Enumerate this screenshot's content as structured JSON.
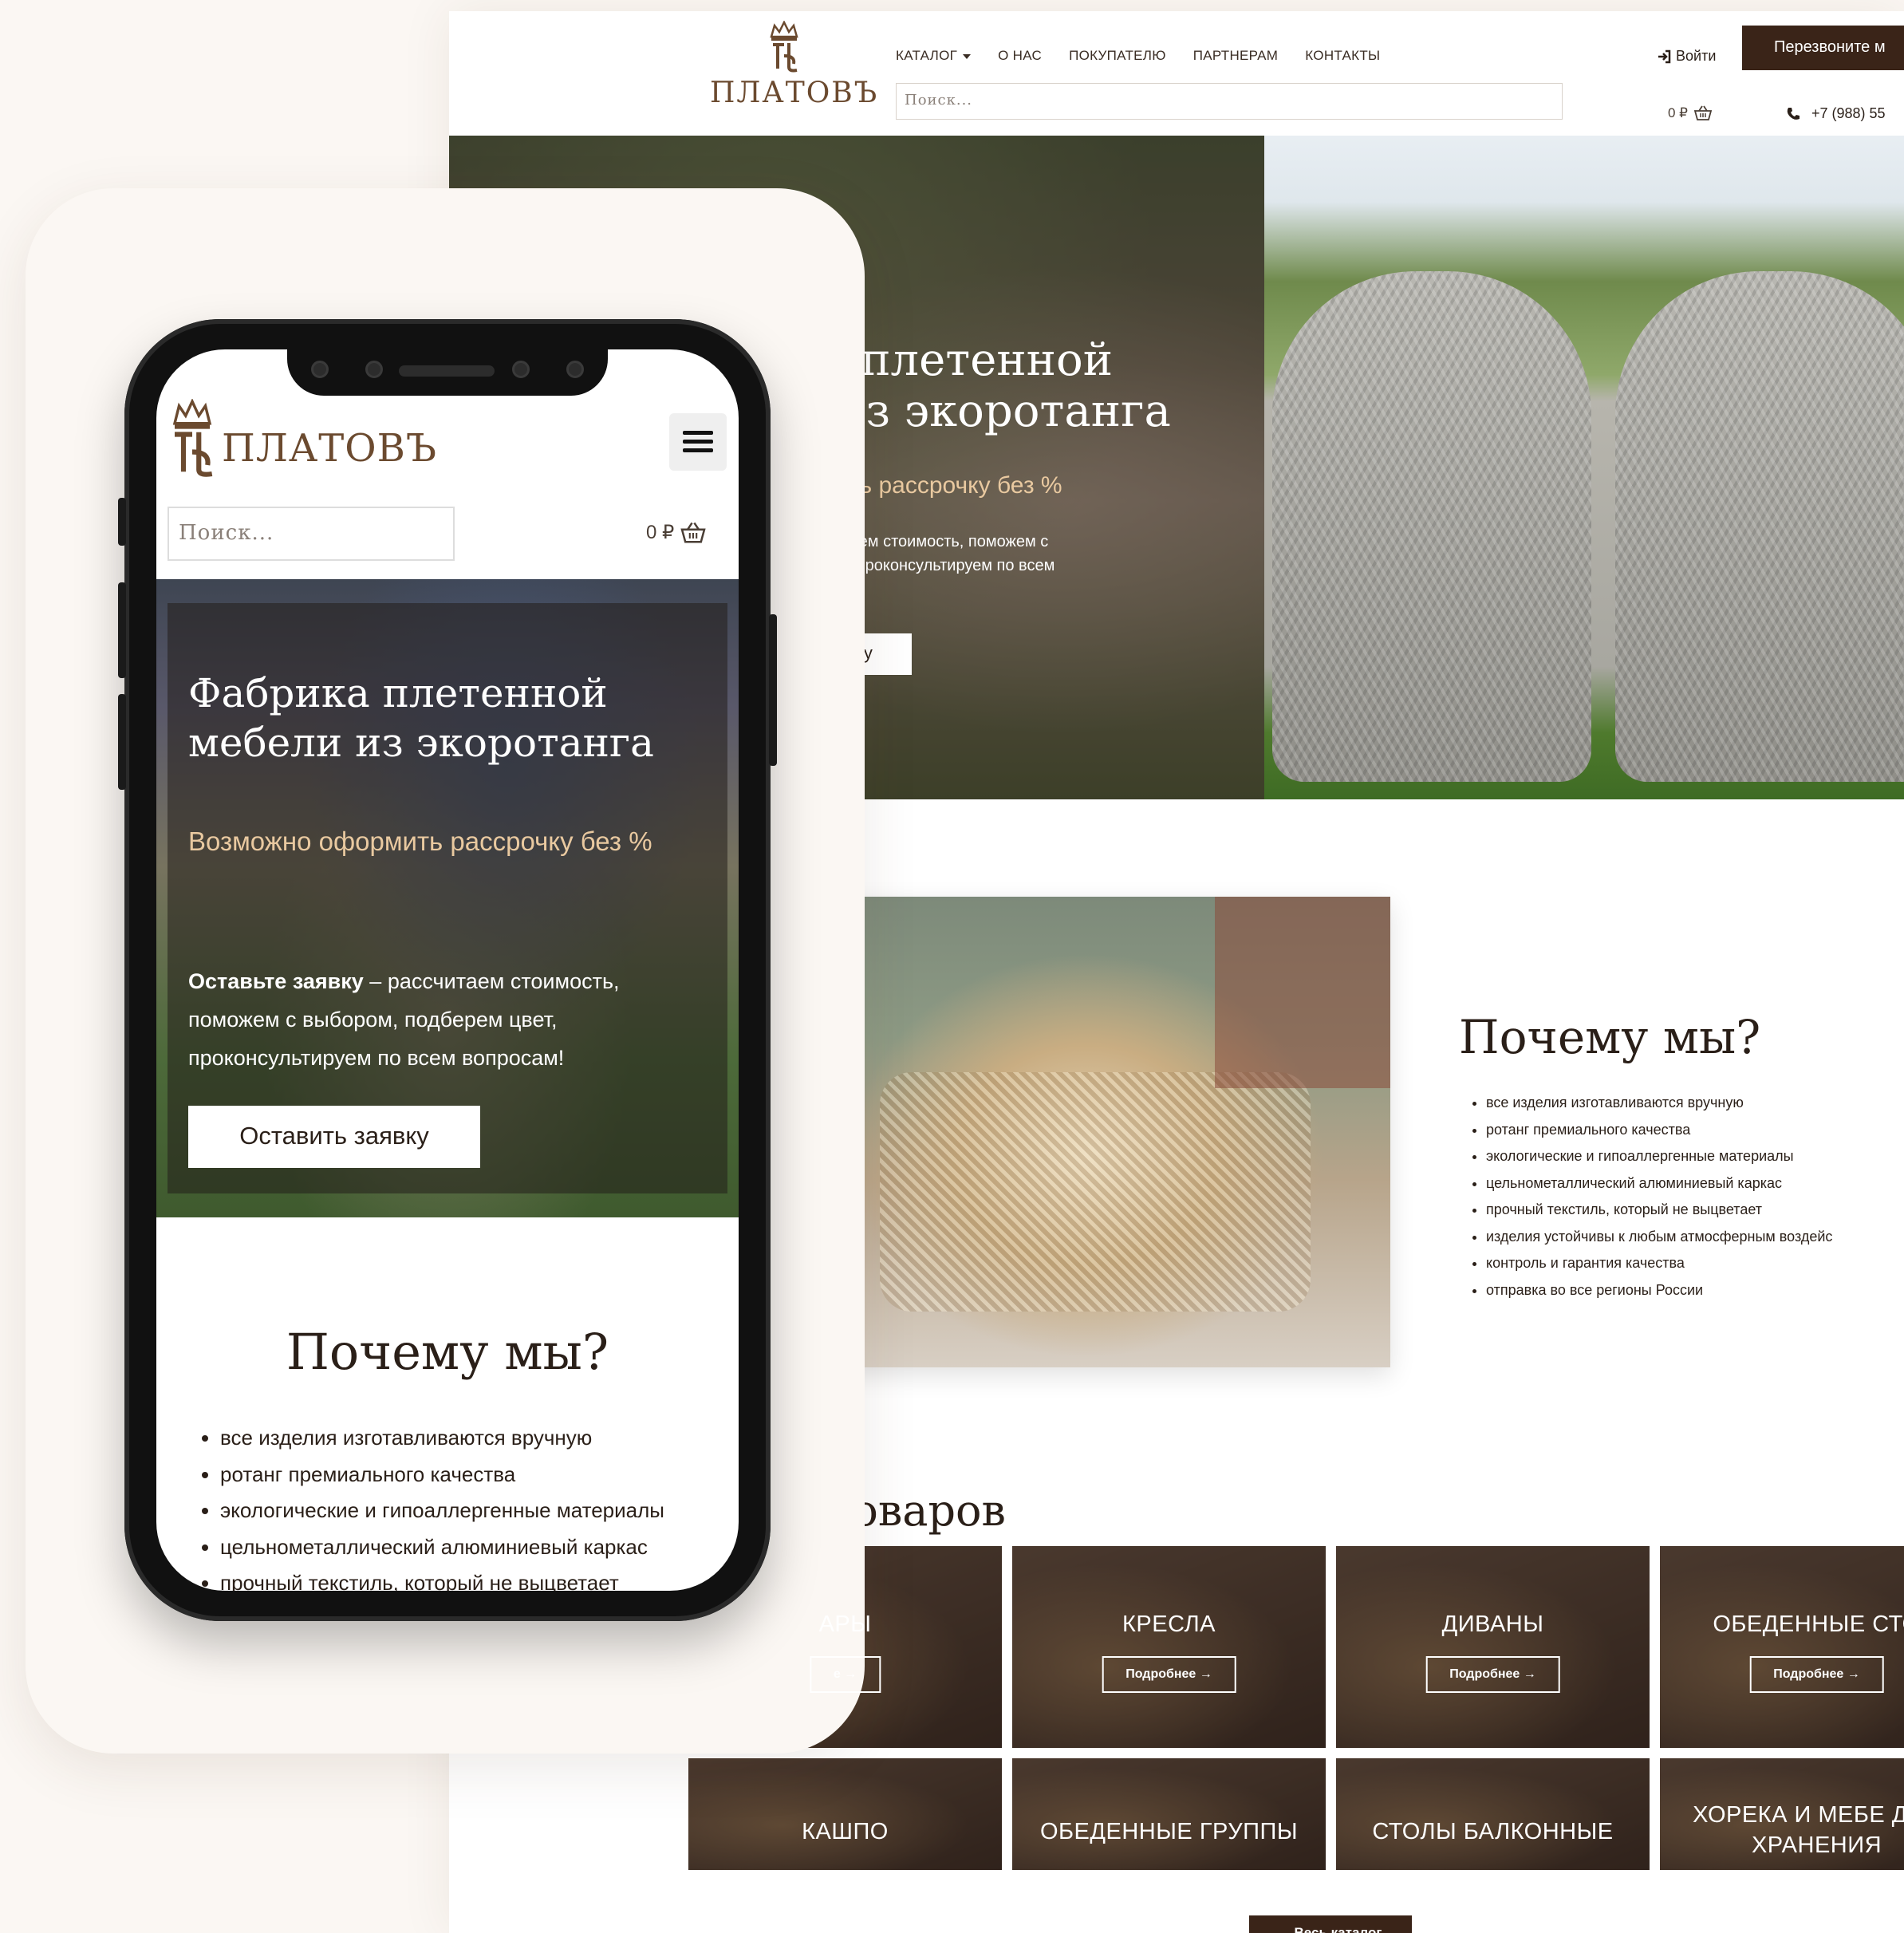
{
  "brand": {
    "name": "ПЛАТОВЪ",
    "accent": "#6b4a2f",
    "dark": "#3a2418"
  },
  "desktop": {
    "nav": [
      "КАТАЛОГ",
      "О НАС",
      "ПОКУПАТЕЛЮ",
      "ПАРТНЕРАМ",
      "КОНТАКТЫ"
    ],
    "search_placeholder": "Поиск...",
    "login": "Войти",
    "callback": "Перезвоните м",
    "cart": "0 ₽",
    "phone": "+7 (988) 55",
    "hero": {
      "title_line1": "ка плетенной",
      "title_line2": "и из экоротанга",
      "subtitle": "ормить рассрочку без %",
      "text_line1": "рассчитаем стоимость, поможем с",
      "text_line2": "ем цвет, проконсультируем по всем",
      "button": "ку"
    },
    "why": {
      "title": "Почему мы?",
      "items": [
        "все изделия изготавливаются вручную",
        "ротанг премиального качества",
        "экологические и гипоаллергенные материалы",
        "цельнометаллический алюминиевый каркас",
        "прочный текстиль, который не выцветает",
        "изделия устойчивы к любым атмосферным воздейс",
        "контроль и гарантия качества",
        "отправка во все регионы России"
      ]
    },
    "catalog": {
      "title": "г товаров",
      "tiles": [
        {
          "label": "АРЫ",
          "button": "е →"
        },
        {
          "label": "КРЕСЛА",
          "button": "Подробнее →"
        },
        {
          "label": "ДИВАНЫ",
          "button": "Подробнее →"
        },
        {
          "label": "ОБЕДЕННЫЕ СТО",
          "button": "Подробнее →"
        }
      ],
      "tiles_row2": [
        "КАШПО",
        "ОБЕДЕННЫЕ ГРУППЫ",
        "СТОЛЫ БАЛКОННЫЕ",
        "ХОРЕКА И МЕБЕ ДЛЯ ХРАНЕНИЯ"
      ],
      "all_button": "Весь каталог"
    }
  },
  "mobile": {
    "search_placeholder": "Поиск...",
    "cart": "0 ₽",
    "hero": {
      "title_line1": "Фабрика плетенной",
      "title_line2": "мебели из экоротанга",
      "subtitle": "Возможно оформить рассрочку без %",
      "text_bold": "Оставьте заявку",
      "text_rest": " – рассчитаем стоимость, поможем с выбором, подберем цвет, проконсультируем по всем вопросам!",
      "button": "Оставить заявку"
    },
    "why": {
      "title": "Почему мы?",
      "items": [
        "все изделия изготавливаются вручную",
        "ротанг премиального качества",
        "экологические и гипоаллергенные материалы",
        "цельнометаллический алюминиевый каркас",
        "прочный текстиль, который не выцветает"
      ]
    }
  }
}
